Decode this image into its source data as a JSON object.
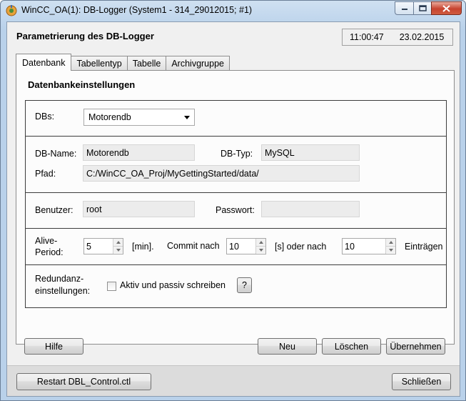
{
  "window": {
    "title": "WinCC_OA(1): DB-Logger (System1 - 314_29012015; #1)",
    "header_title": "Parametrierung des DB-Logger",
    "clock_time": "11:00:47",
    "clock_date": "23.02.2015"
  },
  "tabs": [
    {
      "label": "Datenbank",
      "active": true
    },
    {
      "label": "Tabellentyp",
      "active": false
    },
    {
      "label": "Tabelle",
      "active": false
    },
    {
      "label": "Archivgruppe",
      "active": false
    }
  ],
  "section_title": "Datenbankeinstellungen",
  "dbs": {
    "label": "DBs:",
    "selected": "Motorendb"
  },
  "db_info": {
    "name_label": "DB-Name:",
    "name_value": "Motorendb",
    "type_label": "DB-Typ:",
    "type_value": "MySQL",
    "path_label": "Pfad:",
    "path_value": "C:/WinCC_OA_Proj/MyGettingStarted/data/"
  },
  "credentials": {
    "user_label": "Benutzer:",
    "user_value": "root",
    "password_label": "Passwort:",
    "password_value": ""
  },
  "alive": {
    "label_line1": "Alive-",
    "label_line2": "Period:",
    "value": "5",
    "unit": "[min].",
    "commit_label": "Commit nach",
    "commit_value": "10",
    "commit_unit": "[s] oder nach",
    "entries_value": "10",
    "entries_unit": "Einträgen"
  },
  "redundancy": {
    "label_line1": "Redundanz-",
    "label_line2": "einstellungen:",
    "checkbox_label": "Aktiv und passiv schreiben",
    "checked": false,
    "help_label": "?"
  },
  "buttons": {
    "help": "Hilfe",
    "new": "Neu",
    "delete": "Löschen",
    "apply": "Übernehmen",
    "restart": "Restart DBL_Control.ctl",
    "close": "Schließen"
  },
  "colors": {
    "title_bar": "#b9d1ea",
    "dialog_bg": "#f0f0f0",
    "close_button": "#c7432f"
  }
}
